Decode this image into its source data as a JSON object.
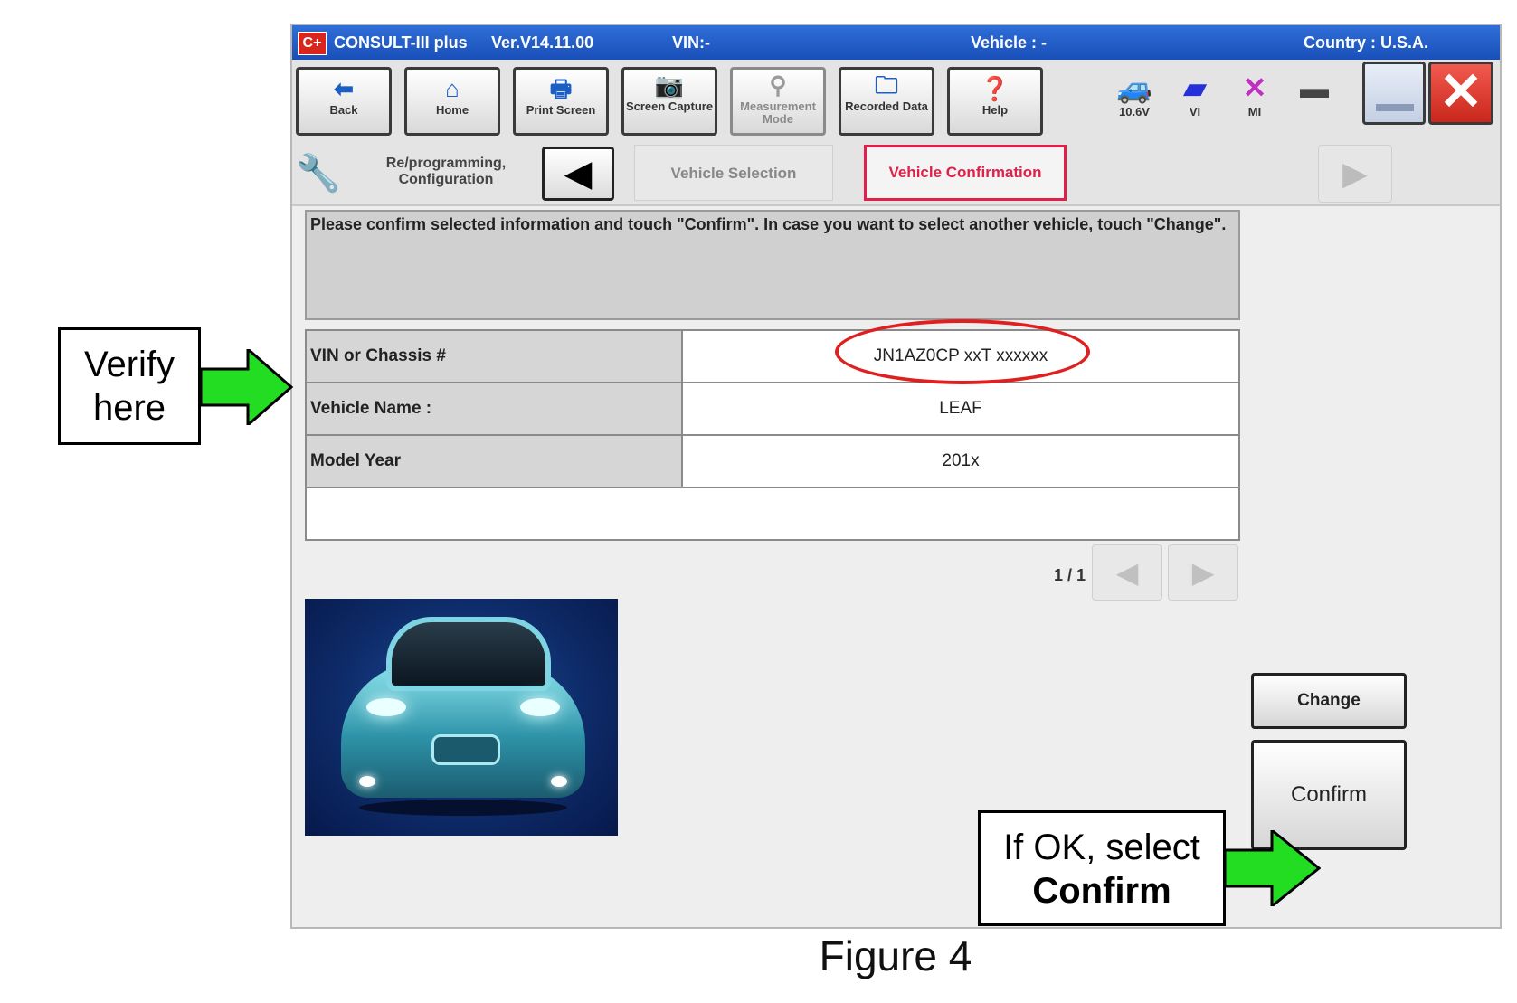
{
  "titlebar": {
    "app": "CONSULT-III plus",
    "version": "Ver.V14.11.00",
    "vin": "VIN:-",
    "vehicle": "Vehicle : -",
    "country": "Country : U.S.A.",
    "logo": "C+"
  },
  "toolbar": {
    "back": "Back",
    "home": "Home",
    "print_screen": "Print Screen",
    "screen_capture": "Screen Capture",
    "measurement_mode": "Measurement Mode",
    "recorded_data": "Recorded Data",
    "help": "Help",
    "battery": "10.6V",
    "vi": "VI",
    "mi": "MI"
  },
  "nav": {
    "section": "Re/programming, Configuration",
    "crumb1": "Vehicle Selection",
    "crumb2": "Vehicle Confirmation"
  },
  "message": "Please confirm selected information and touch \"Confirm\". In case you want to select another vehicle, touch \"Change\".",
  "table": {
    "rows": [
      {
        "label": "VIN or Chassis #",
        "value": "JN1AZ0CP xxT xxxxxx"
      },
      {
        "label": "Vehicle Name :",
        "value": "LEAF"
      },
      {
        "label": "Model Year",
        "value": "201x"
      }
    ]
  },
  "pager": "1 / 1",
  "buttons": {
    "change": "Change",
    "confirm": "Confirm"
  },
  "callouts": {
    "verify": "Verify here",
    "ok_prefix": "If OK, select",
    "ok_bold": "Confirm"
  },
  "caption": "Figure 4",
  "colors": {
    "titlebar": "#1a4fb8",
    "active_crumb": "#e02048",
    "arrow": "#22dd22"
  }
}
